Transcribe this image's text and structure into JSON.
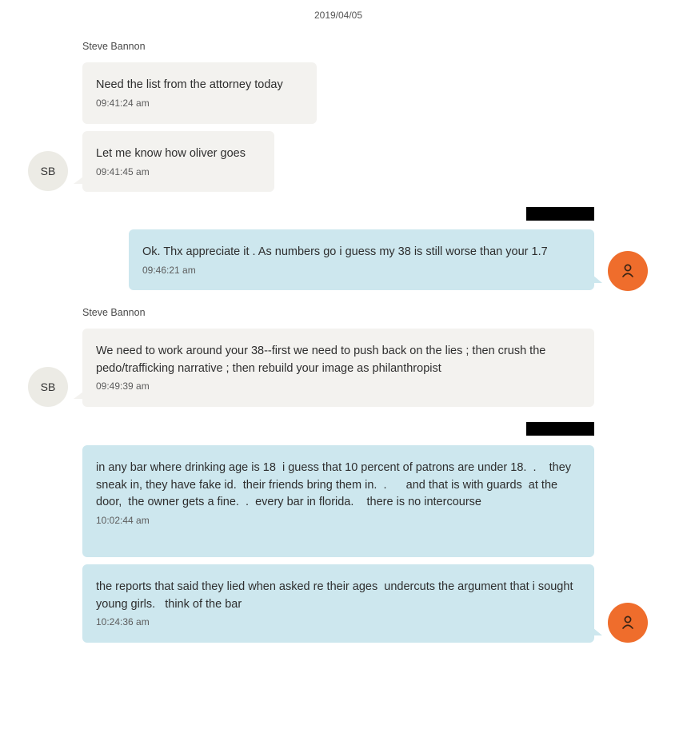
{
  "conversation": {
    "date": "2019/04/05"
  },
  "groups": [
    {
      "sender_name": "Steve Bannon",
      "avatar_initials": "SB",
      "messages": [
        {
          "text": "Need the list from the attorney today",
          "time": "09:41:24 am"
        },
        {
          "text": "Let me know how oliver goes",
          "time": "09:41:45 am"
        }
      ]
    },
    {
      "sender_name": "",
      "avatar_icon": "person-icon",
      "messages": [
        {
          "text": "Ok. Thx appreciate it . As numbers go i guess my 38 is still worse than your 1.7",
          "time": "09:46:21 am"
        }
      ]
    },
    {
      "sender_name": "Steve Bannon",
      "avatar_initials": "SB",
      "messages": [
        {
          "text": "We need to work around your 38--first we need to push back on the lies ; then crush the pedo/trafficking narrative ; then rebuild your image as philanthropist",
          "time": "09:49:39 am"
        }
      ]
    },
    {
      "sender_name": "",
      "avatar_icon": "person-icon",
      "messages": [
        {
          "text": "in any bar where drinking age is 18  i guess that 10 percent of patrons are under 18.  .    they sneak in, they have fake id.  their friends bring them in.  .      and that is with guards  at the door,  the owner gets a fine.  .  every bar in florida.    there is no intercourse",
          "time": "10:02:44 am"
        },
        {
          "text": "the reports that said they lied when asked re their ages  undercuts the argument that i sought young girls.   think of the bar",
          "time": "10:24:36 am"
        }
      ]
    }
  ],
  "colors": {
    "incoming_bubble": "#f3f2ef",
    "outgoing_bubble": "#cde7ee",
    "my_avatar": "#ef6d2c",
    "sb_avatar": "#ecebe5",
    "redaction": "#000000"
  }
}
